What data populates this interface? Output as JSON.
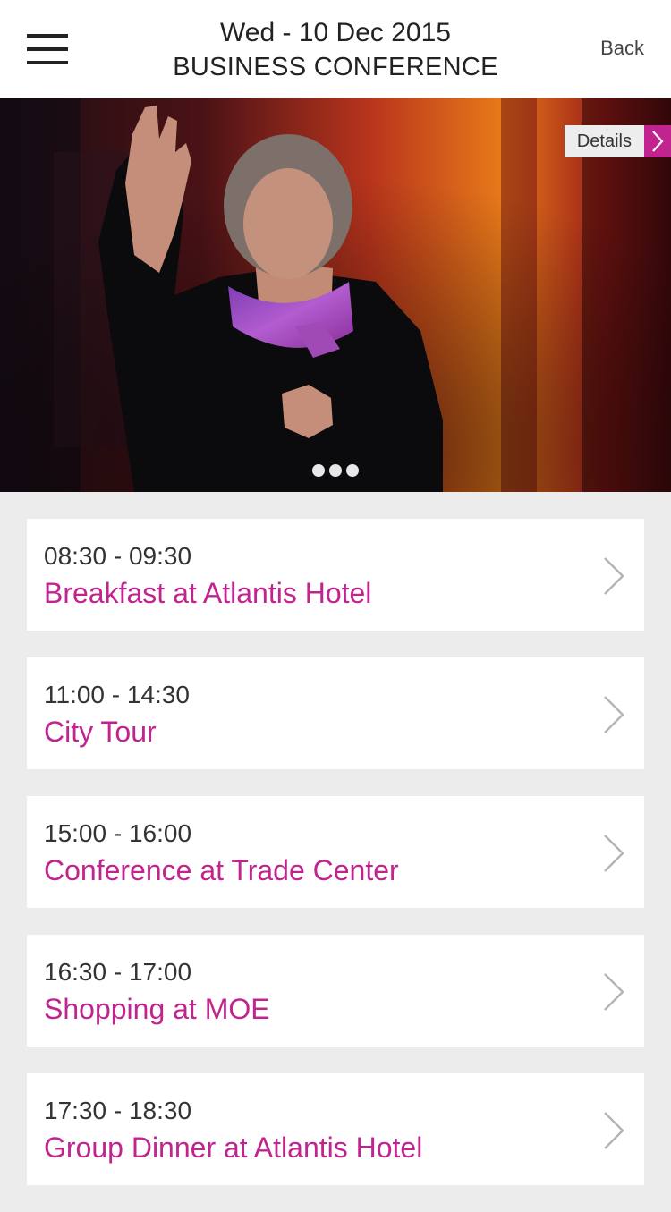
{
  "header": {
    "date": "Wed - 10 Dec 2015",
    "event": "BUSINESS CONFERENCE",
    "back_label": "Back",
    "menu_icon": "hamburger-menu-icon"
  },
  "hero": {
    "details_label": "Details",
    "slide_count": 3,
    "active_slide": 1
  },
  "colors": {
    "accent": "#c2248f",
    "background": "#ececec",
    "text": "#333333"
  },
  "schedule": [
    {
      "time": "08:30 - 09:30",
      "title": "Breakfast at Atlantis Hotel"
    },
    {
      "time": "11:00 - 14:30",
      "title": "City Tour"
    },
    {
      "time": "15:00 - 16:00",
      "title": "Conference at Trade Center"
    },
    {
      "time": "16:30 - 17:00",
      "title": "Shopping at MOE"
    },
    {
      "time": "17:30 - 18:30",
      "title": "Group Dinner at Atlantis Hotel"
    }
  ]
}
